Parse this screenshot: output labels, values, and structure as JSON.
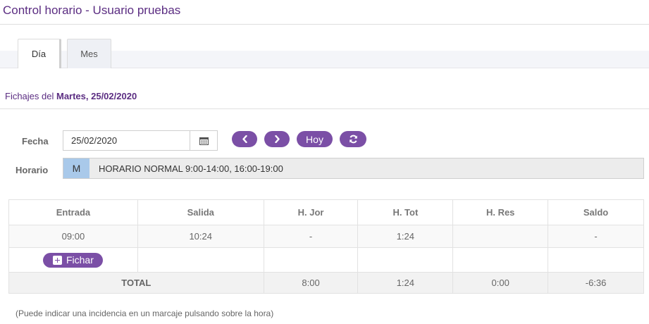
{
  "header": {
    "title": "Control horario - Usuario pruebas"
  },
  "tabs": [
    {
      "label": "Día",
      "active": true
    },
    {
      "label": "Mes",
      "active": false
    }
  ],
  "fichajes": {
    "prefix": "Fichajes del ",
    "day": "Martes, 25/02/2020"
  },
  "form": {
    "fecha_label": "Fecha",
    "fecha_value": "25/02/2020",
    "calendar_icon": "calendar-icon",
    "nav_buttons": {
      "prev_icon": "chevron-left-icon",
      "next_icon": "chevron-right-icon",
      "hoy_label": "Hoy",
      "refresh_icon": "refresh-icon"
    },
    "horario_label": "Horario",
    "horario_badge": "M",
    "horario_text": "HORARIO NORMAL 9:00-14:00, 16:00-19:00"
  },
  "table": {
    "headers": [
      "Entrada",
      "Salida",
      "H. Jor",
      "H. Tot",
      "H. Res",
      "Saldo"
    ],
    "rows": [
      [
        "09:00",
        "10:24",
        "-",
        "1:24",
        "",
        "-"
      ]
    ],
    "fichar_label": "Fichar",
    "total": {
      "label": "TOTAL",
      "h_jor": "8:00",
      "h_tot": "1:24",
      "h_res": "0:00",
      "saldo": "-6:36"
    }
  },
  "note": "(Puede indicar una incidencia en un marcaje pulsando sobre la hora)",
  "colors": {
    "brand_purple": "#7b4fa6",
    "title_purple": "#5b2d82",
    "badge_blue": "#a9c9ea"
  }
}
